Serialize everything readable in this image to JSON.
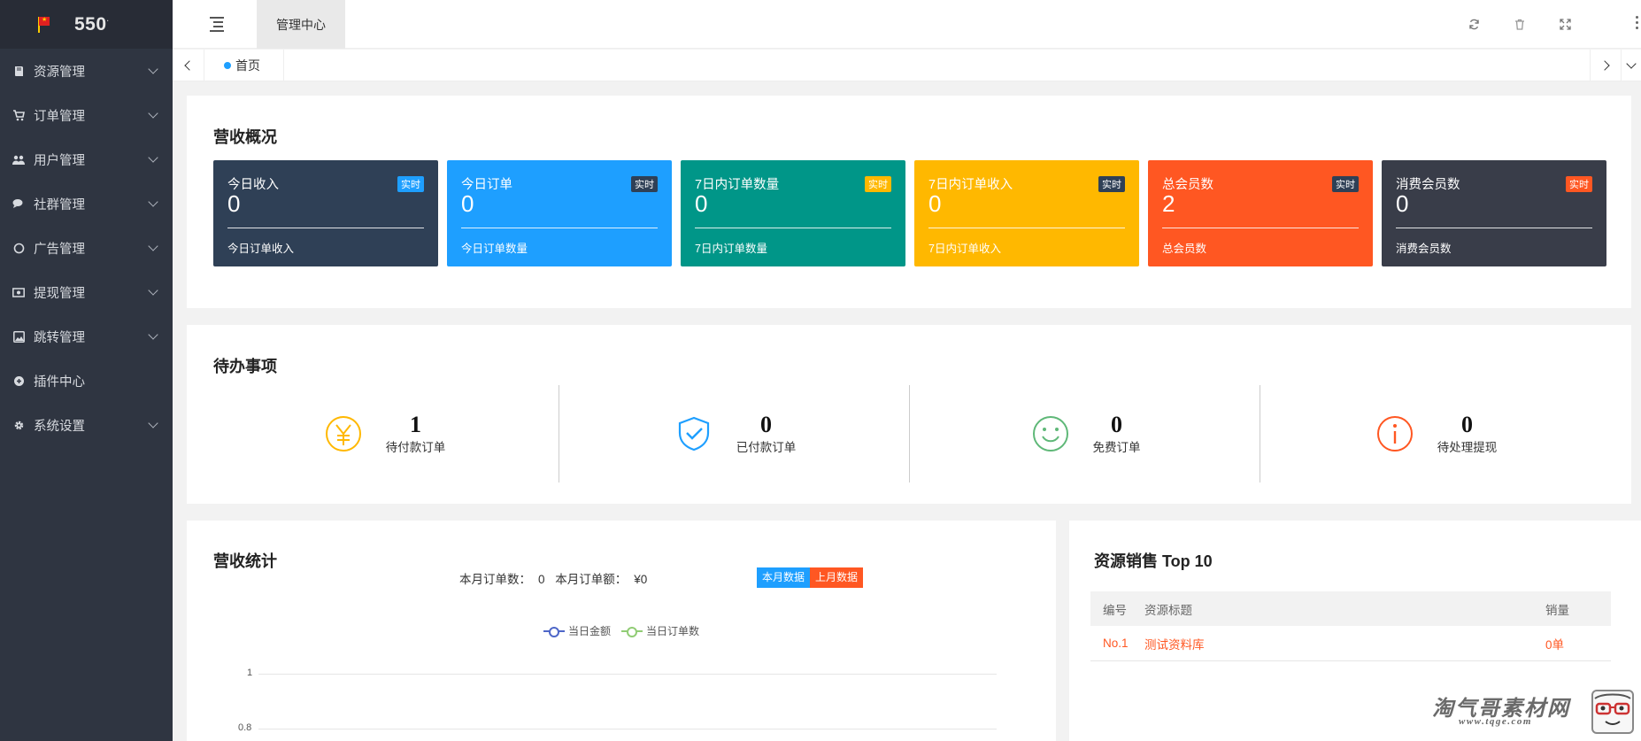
{
  "app": {
    "logo_text": "550"
  },
  "sidebar": {
    "items": [
      {
        "label": "资源管理",
        "icon": "book-icon",
        "has_submenu": true
      },
      {
        "label": "订单管理",
        "icon": "cart-icon",
        "has_submenu": true
      },
      {
        "label": "用户管理",
        "icon": "users-icon",
        "has_submenu": true
      },
      {
        "label": "社群管理",
        "icon": "chat-icon",
        "has_submenu": true
      },
      {
        "label": "广告管理",
        "icon": "circle-icon",
        "has_submenu": true
      },
      {
        "label": "提现管理",
        "icon": "money-icon",
        "has_submenu": true
      },
      {
        "label": "跳转管理",
        "icon": "image-icon",
        "has_submenu": true
      },
      {
        "label": "插件中心",
        "icon": "plugin-icon",
        "has_submenu": false
      },
      {
        "label": "系统设置",
        "icon": "gear-icon",
        "has_submenu": true
      }
    ]
  },
  "header": {
    "active_tab": "管理中心"
  },
  "tabs": {
    "home": "首页"
  },
  "overview": {
    "title": "营收概况",
    "stats": [
      {
        "title": "今日收入",
        "value": "0",
        "badge": "实时",
        "footer": "今日订单收入",
        "bg": "#2f4056",
        "badge_bg": "#1e9fff"
      },
      {
        "title": "今日订单",
        "value": "0",
        "badge": "实时",
        "footer": "今日订单数量",
        "bg": "#1e9fff",
        "badge_bg": "#2f4056"
      },
      {
        "title": "7日内订单数量",
        "value": "0",
        "badge": "实时",
        "footer": "7日内订单数量",
        "bg": "#009688",
        "badge_bg": "#ffb800"
      },
      {
        "title": "7日内订单收入",
        "value": "0",
        "badge": "实时",
        "footer": "7日内订单收入",
        "bg": "#ffb800",
        "badge_bg": "#2f4056"
      },
      {
        "title": "总会员数",
        "value": "2",
        "badge": "实时",
        "footer": "总会员数",
        "bg": "#ff5722",
        "badge_bg": "#2f4056"
      },
      {
        "title": "消费会员数",
        "value": "0",
        "badge": "实时",
        "footer": "消费会员数",
        "bg": "#393d49",
        "badge_bg": "#ff5722"
      }
    ]
  },
  "todo": {
    "title": "待办事项",
    "items": [
      {
        "value": "1",
        "label": "待付款订单",
        "icon": "yen-icon",
        "color": "#ffb800"
      },
      {
        "value": "0",
        "label": "已付款订单",
        "icon": "shield-check-icon",
        "color": "#1e9fff"
      },
      {
        "value": "0",
        "label": "免费订单",
        "icon": "smile-icon",
        "color": "#5fb878"
      },
      {
        "value": "0",
        "label": "待处理提现",
        "icon": "info-icon",
        "color": "#ff5722"
      }
    ]
  },
  "revenue": {
    "title": "营收统计",
    "month_orders_label": "本月订单数：",
    "month_orders_value": "0",
    "month_amount_label": "本月订单额：",
    "month_amount_value": "¥0",
    "btn_this_month": "本月数据",
    "btn_last_month": "上月数据",
    "legend_amount": "当日金额",
    "legend_orders": "当日订单数"
  },
  "chart_data": {
    "type": "line",
    "series": [
      {
        "name": "当日金额",
        "values": []
      },
      {
        "name": "当日订单数",
        "values": []
      }
    ],
    "yticks": [
      "1",
      "0.8"
    ],
    "ylim": [
      0,
      1
    ],
    "grid": true,
    "colors": [
      "#4e67c8",
      "#91cc75"
    ]
  },
  "top10": {
    "title": "资源销售 Top 10",
    "columns": [
      "编号",
      "资源标题",
      "销量"
    ],
    "rows": [
      [
        "No.1",
        "测试资料库",
        "0单"
      ]
    ]
  },
  "watermark": {
    "text": "淘气哥素材网",
    "url": "www.tqge.com"
  }
}
